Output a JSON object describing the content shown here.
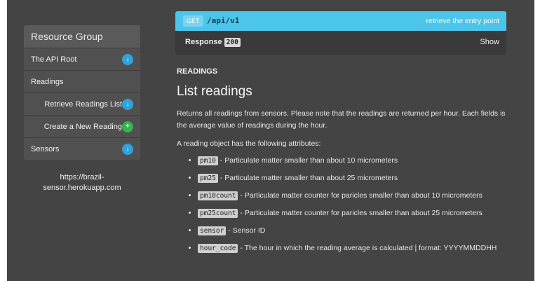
{
  "sidebar": {
    "title": "Resource Group",
    "items": [
      {
        "label": "The API Root",
        "badge": "blue"
      },
      {
        "label": "Readings"
      },
      {
        "label": "Retrieve Readings List",
        "badge": "blue"
      },
      {
        "label": "Create a New Reading",
        "badge": "green"
      },
      {
        "label": "Sensors",
        "badge": "blue"
      }
    ],
    "host_line1": "https://brazil-",
    "host_line2": "sensor.herokuapp.com"
  },
  "endpoint": {
    "method": "GET",
    "path": "/api/v1",
    "description": "retrieve the entry point"
  },
  "response": {
    "label": "Response",
    "code": "200",
    "toggle": "Show"
  },
  "content": {
    "section": "READINGS",
    "title": "List readings",
    "paragraph": "Returns all readings from sensors. Please note that the readings are returned per hour. Each fields is the average value of readings during the hour.",
    "intro": "A reading object has the following attributes:",
    "attributes": [
      {
        "name": "pm10",
        "desc": " - Particulate matter smaller than about 10 micrometers"
      },
      {
        "name": "pm25",
        "desc": " - Particulate matter smaller than about 25 micrometers"
      },
      {
        "name": "pm10count",
        "desc": " - Particulate matter counter for paricles smaller than about 10 micrometers"
      },
      {
        "name": "pm25count",
        "desc": " - Particulate matter counter for paricles smaller than about 25 micrometers"
      },
      {
        "name": "sensor",
        "desc": " - Sensor ID"
      },
      {
        "name": "hour_code",
        "desc": " - The hour in which the reading average is calculated | format: YYYYMMDDHH"
      }
    ]
  },
  "colors": {
    "endpoint_bg": "#4cc5ea",
    "badge_blue": "#2fa3da",
    "badge_green": "#37b24d"
  }
}
